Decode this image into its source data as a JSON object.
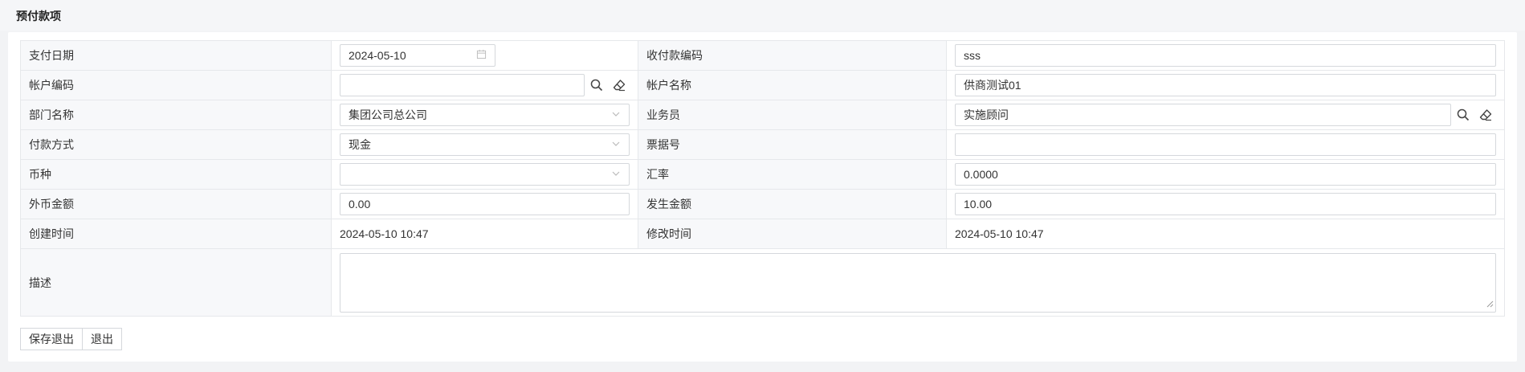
{
  "header": {
    "title": "预付款项"
  },
  "form": {
    "pay_date": {
      "label": "支付日期",
      "value": "2024-05-10"
    },
    "receipt_code": {
      "label": "收付款编码",
      "value": "sss"
    },
    "account_code": {
      "label": "帐户编码",
      "value": ""
    },
    "account_name": {
      "label": "帐户名称",
      "value": "供商测试01"
    },
    "department": {
      "label": "部门名称",
      "value": "集团公司总公司"
    },
    "salesperson": {
      "label": "业务员",
      "value": "实施顾问"
    },
    "pay_method": {
      "label": "付款方式",
      "value": "现金"
    },
    "bill_no": {
      "label": "票据号",
      "value": ""
    },
    "currency": {
      "label": "币种",
      "value": ""
    },
    "exchange_rate": {
      "label": "汇率",
      "value": "0.0000"
    },
    "foreign_amount": {
      "label": "外币金额",
      "value": "0.00"
    },
    "amount": {
      "label": "发生金额",
      "value": "10.00"
    },
    "created_at": {
      "label": "创建时间",
      "value": "2024-05-10 10:47"
    },
    "modified_at": {
      "label": "修改时间",
      "value": "2024-05-10 10:47"
    },
    "description": {
      "label": "描述",
      "value": ""
    }
  },
  "buttons": {
    "save_exit": "保存退出",
    "exit": "退出"
  },
  "icons": {
    "calendar": "calendar-icon",
    "search": "search-icon",
    "eraser": "eraser-icon",
    "dropdown": "chevron-down-icon"
  }
}
